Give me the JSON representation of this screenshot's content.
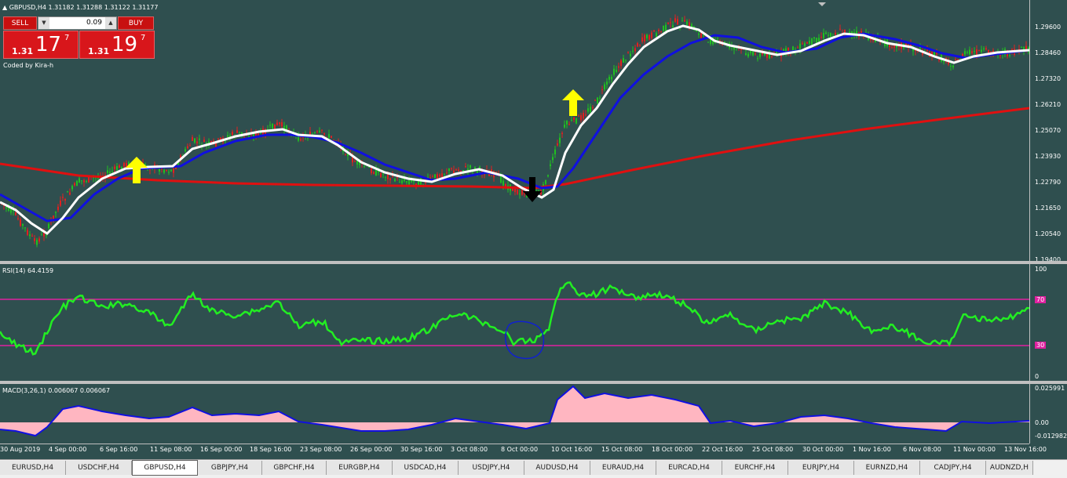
{
  "header": {
    "symbol": "GBPUSD,H4",
    "ohlc": "1.31182 1.31288 1.31122 1.31177",
    "coded_by": "Coded by Kira-h"
  },
  "trade_panel": {
    "sell_label": "SELL",
    "buy_label": "BUY",
    "lot_value": "0.09",
    "sell_price_small": "1.31",
    "sell_price_big": "17",
    "sell_price_sup": "7",
    "buy_price_small": "1.31",
    "buy_price_big": "19",
    "buy_price_sup": "7"
  },
  "price_axis": [
    "1.29600",
    "1.28460",
    "1.27320",
    "1.26210",
    "1.25070",
    "1.23930",
    "1.22790",
    "1.21650",
    "1.20540",
    "1.19400"
  ],
  "rsi": {
    "label": "RSI(14) 64.4159",
    "levels": [
      "100",
      "70",
      "30",
      "0"
    ]
  },
  "macd": {
    "label": "MACD(3,26,1) 0.006067 0.006067",
    "levels": [
      "0.025991",
      "0.00",
      "-0.012982"
    ]
  },
  "time_axis": [
    "30 Aug 2019",
    "4 Sep 00:00",
    "6 Sep 16:00",
    "11 Sep 08:00",
    "16 Sep 00:00",
    "18 Sep 16:00",
    "23 Sep 08:00",
    "26 Sep 00:00",
    "30 Sep 16:00",
    "3 Oct 08:00",
    "8 Oct 00:00",
    "10 Oct 16:00",
    "15 Oct 08:00",
    "18 Oct 00:00",
    "22 Oct 16:00",
    "25 Oct 08:00",
    "30 Oct 00:00",
    "1 Nov 16:00",
    "6 Nov 08:00",
    "11 Nov 00:00",
    "13 Nov 16:00"
  ],
  "tabs": [
    "EURUSD,H4",
    "USDCHF,H4",
    "GBPUSD,H4",
    "GBPJPY,H4",
    "GBPCHF,H4",
    "EURGBP,H4",
    "USDCAD,H4",
    "USDJPY,H4",
    "AUDUSD,H4",
    "EURAUD,H4",
    "EURCAD,H4",
    "EURCHF,H4",
    "EURJPY,H4",
    "EURNZD,H4",
    "CADJPY,H4",
    "AUDNZD,H"
  ],
  "active_tab": "GBPUSD,H4",
  "colors": {
    "background": "#2f4f4f",
    "ma_red": "#e01010",
    "ma_blue": "#1010e0",
    "ma_white": "#ffffff",
    "rsi_line": "#22ee22",
    "rsi_level": "#e020a0",
    "macd_fill": "#ffb6c1",
    "macd_signal": "#1010e0",
    "arrow_up": "#ffff00",
    "arrow_down": "#000000"
  }
}
